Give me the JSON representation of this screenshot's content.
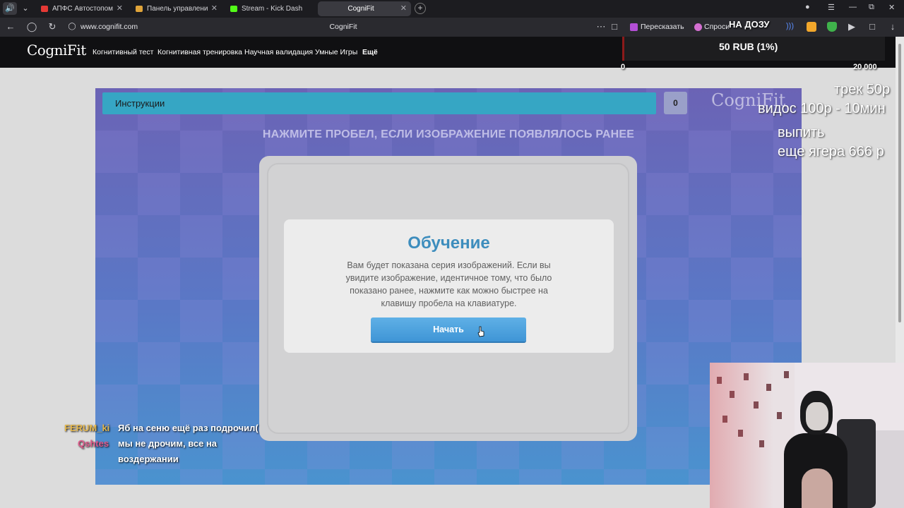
{
  "browser": {
    "tabs": [
      {
        "title": "АПФС Автостопом",
        "favicon_color": "#e53935",
        "active": false
      },
      {
        "title": "Панель управления - Don",
        "favicon_color": "#e0a43a",
        "active": false
      },
      {
        "title": "Stream - Kick Dashboard",
        "favicon_color": "#53fc18",
        "active": false
      },
      {
        "title": "CogniFit",
        "favicon_color": "#8a8a8a",
        "active": true
      }
    ],
    "url": "www.cognifit.com",
    "page_title": "CogniFit",
    "retell_label": "Пересказать",
    "ask_label": "Спросить",
    "accent": "#3a3a40"
  },
  "site": {
    "logo": "CogniFit",
    "nav": [
      {
        "label": "Когнитивный тест"
      },
      {
        "label": "Когнитивная тренировка"
      },
      {
        "label": "Научная валидация"
      },
      {
        "label": "Умные Игры"
      },
      {
        "label": "Ещё"
      }
    ]
  },
  "game": {
    "instructions_label": "Инструкции",
    "score": "0",
    "logo": "CogniFit",
    "headline": "НАЖМИТЕ ПРОБЕЛ, ЕСЛИ ИЗОБРАЖЕНИЕ ПОЯВЛЯЛОСЬ РАНЕЕ",
    "modal": {
      "title": "Обучение",
      "text": "Вам будет показана серия изображений. Если вы увидите изображение, идентичное тому, что было показано ранее, нажмите как можно быстрее на клавишу пробела на клавиатуре.",
      "start_label": "Начать"
    }
  },
  "overlay": {
    "donation": {
      "title": "НА ДОЗУ",
      "amount": "50 RUB (1%)",
      "min": "0",
      "max": "20 000",
      "progress_fraction": 0.0025
    },
    "prices": [
      "трек 50р",
      "видос 100р - 10мин",
      "выпить",
      "еще  ягера 666 р"
    ],
    "chat": [
      {
        "user": "FERUM_ki",
        "message": "Яб на сеню ещё раз подрочил("
      },
      {
        "user": "Qshtes",
        "message": "мы не дрочим, все на"
      },
      {
        "user": "",
        "message": "воздержании"
      }
    ]
  }
}
